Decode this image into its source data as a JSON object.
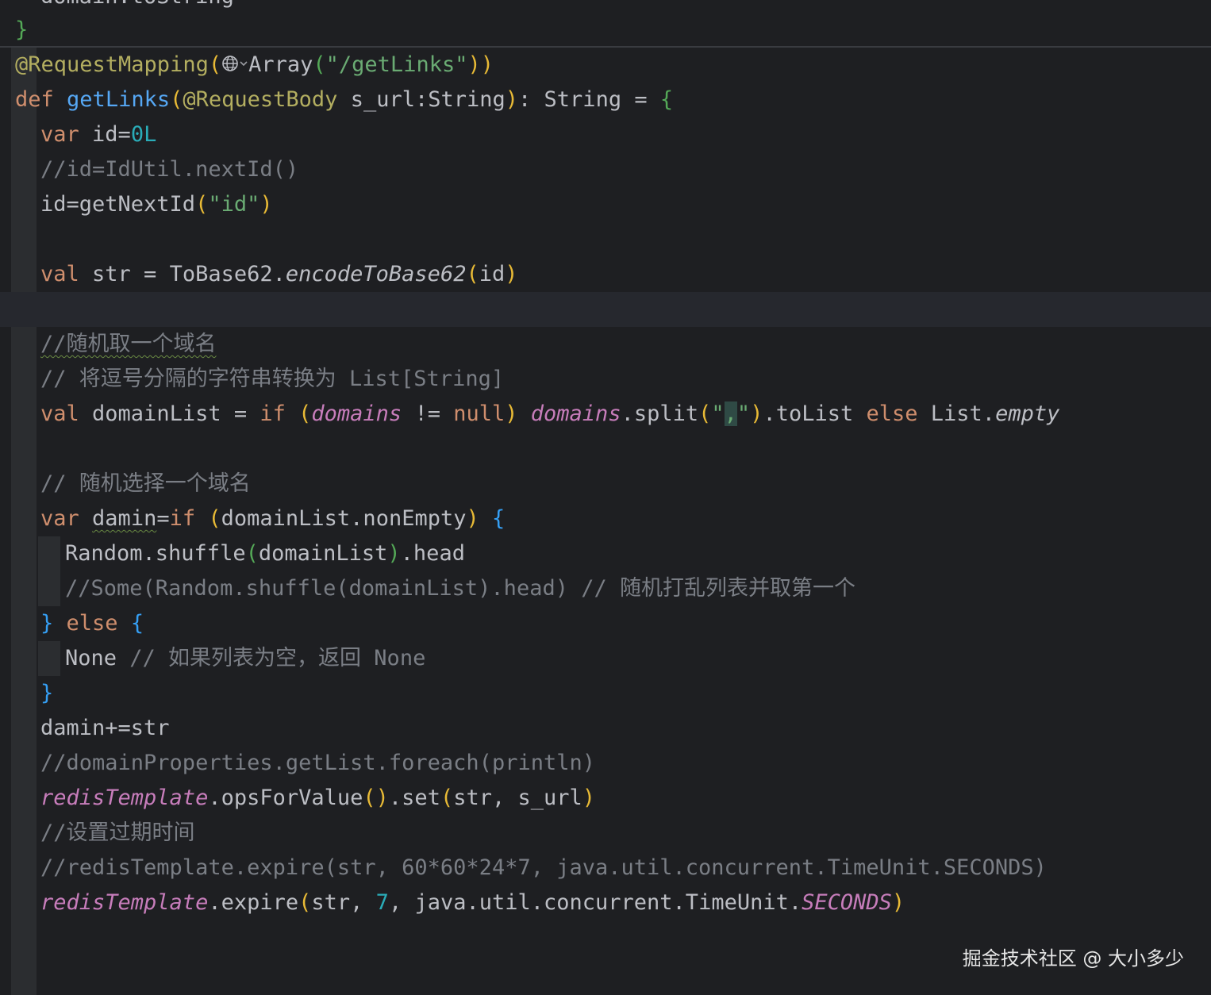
{
  "editor": {
    "top_fragment": "domain.toString",
    "closing_brace": "}",
    "annotation": {
      "name": "@RequestMapping",
      "open": "(",
      "type": "Array",
      "args_open": "(",
      "path": "\"/getLinks\"",
      "close": "))"
    },
    "def_line": {
      "kw": "def",
      "name": "getLinks",
      "open": "(",
      "param_ann": "@RequestBody",
      "params": " s_url:String",
      "close": ")",
      "ret": ": String = ",
      "brace": "{"
    },
    "lines": {
      "var_id": {
        "kw": "var",
        "rest": " id=",
        "num": "0L"
      },
      "cmt_nextid": "//id=IdUtil.nextId()",
      "id_assign": {
        "pre": "id=getNextId",
        "open": "(",
        "str": "\"id\"",
        "close": ")"
      },
      "val_str": {
        "kw": "val",
        "pre": " str = ToBase62.",
        "method": "encodeToBase62",
        "open": "(",
        "arg": "id",
        "close": ")"
      },
      "cmt_random_domain": "//随机取一个域名",
      "cmt_split": "// 将逗号分隔的字符串转换为 List[String]",
      "domain_list": {
        "kw_val": "val",
        "name": " domainList = ",
        "kw_if": "if",
        "open": " (",
        "field1": "domains",
        "neq": " != ",
        "null_kw": "null",
        "close": ")",
        "field2": "domains",
        "split": ".split",
        "sopen": "(",
        "q1": "\"",
        "comma": ",",
        "q2": "\"",
        "sclose": ")",
        "tolist": ".toList ",
        "kw_else": "else",
        "list": " List.",
        "empty": "empty"
      },
      "cmt_pick": "// 随机选择一个域名",
      "var_damin": {
        "kw": "var",
        "sp": " ",
        "name": "damin",
        "eq": "=",
        "kw_if": "if",
        "open": " (",
        "cond": "domainList.nonEmpty",
        "close": ")",
        "brace": " {"
      },
      "shuffle": {
        "pre": "Random.shuffle",
        "open": "(",
        "arg": "domainList",
        "close": ")",
        "post": ".head"
      },
      "cmt_some": "//Some(Random.shuffle(domainList).head) // 随机打乱列表并取第一个",
      "else_line": {
        "brace1": "}",
        "kw": " else ",
        "brace2": "{"
      },
      "none_line": {
        "val": "None ",
        "cmt": "// 如果列表为空，返回 None"
      },
      "close_brace": "}",
      "damin_append": "damin+=str",
      "cmt_domain_props": "//domainProperties.getList.foreach(println)",
      "redis_set": {
        "field": "redisTemplate",
        "pre": ".opsForValue",
        "p1": "()",
        "mid": ".set",
        "open": "(",
        "args": "str, s_url",
        "close": ")"
      },
      "cmt_expire_cn": "//设置过期时间",
      "cmt_expire": "//redisTemplate.expire(str, 60*60*24*7, java.util.concurrent.TimeUnit.SECONDS)",
      "redis_expire": {
        "field": "redisTemplate",
        "pre": ".expire",
        "open": "(",
        "a1": "str, ",
        "num": "7",
        "a2": ", java.util.concurrent.TimeUnit.",
        "const": "SECONDS",
        "close": ")"
      }
    }
  },
  "watermark": "掘金技术社区 @ 大小多少",
  "icons": {
    "globe": "globe-icon",
    "chevron": "chevron-down-icon"
  },
  "colors": {
    "background": "#1e1f22",
    "keyword": "#cf8e6d",
    "function": "#56a8f5",
    "annotation": "#b3ae60",
    "string": "#6aab73",
    "number": "#2aacb8",
    "comment": "#7a7e85",
    "field": "#c77dbb"
  }
}
